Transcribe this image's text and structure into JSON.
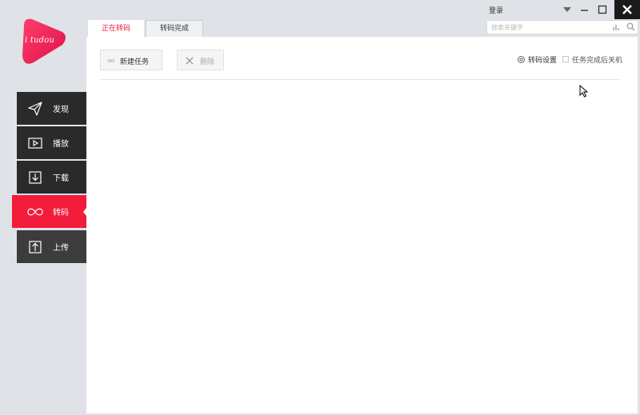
{
  "logo": {
    "text": "i tudou"
  },
  "sidebar": {
    "items": [
      {
        "label": "发现",
        "icon": "send-icon"
      },
      {
        "label": "播放",
        "icon": "play-icon"
      },
      {
        "label": "下载",
        "icon": "download-icon"
      },
      {
        "label": "转码",
        "icon": "infinity-icon",
        "active": true
      },
      {
        "label": "上传",
        "icon": "upload-icon"
      }
    ]
  },
  "header": {
    "tabs": [
      {
        "label": "正在转码",
        "active": true
      },
      {
        "label": "转码完成",
        "active": false
      }
    ],
    "login_label": "登录",
    "search": {
      "placeholder": "搜索关键字"
    }
  },
  "toolbar": {
    "new_task_label": "新建任务",
    "delete_label": "删除",
    "settings_label": "转码设置",
    "shutdown_label": "任务完成后关机",
    "shutdown_checked": false
  },
  "colors": {
    "accent": "#f21c3b",
    "sidebar_dark": "#2a2a2a",
    "background": "#dfe2e6"
  }
}
